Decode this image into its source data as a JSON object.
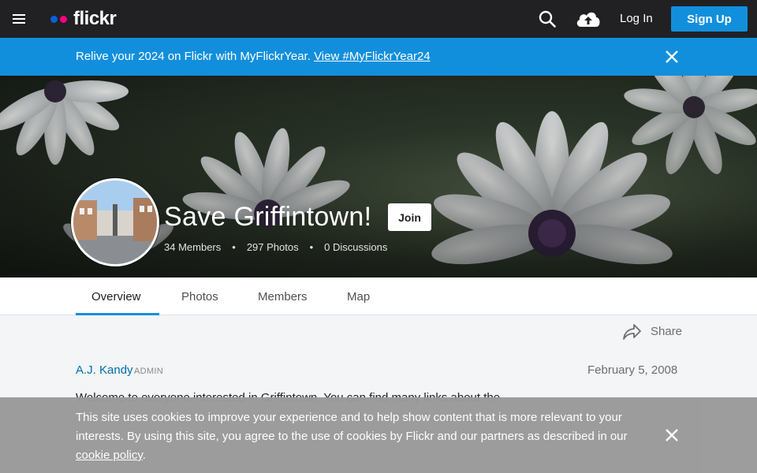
{
  "nav": {
    "logo_text": "flickr",
    "login_label": "Log In",
    "signup_label": "Sign Up"
  },
  "banner": {
    "text": "Relive your 2024 on Flickr with MyFlickrYear.",
    "link_text": "View #MyFlickrYear24"
  },
  "group": {
    "title": "Save Griffintown!",
    "join_label": "Join",
    "members": "34 Members",
    "photos": "297 Photos",
    "discussions": "0 Discussions",
    "separator": "•"
  },
  "tabs": [
    {
      "label": "Overview",
      "active": true
    },
    {
      "label": "Photos",
      "active": false
    },
    {
      "label": "Members",
      "active": false
    },
    {
      "label": "Map",
      "active": false
    }
  ],
  "content": {
    "share_label": "Share",
    "author": "A.J. Kandy",
    "role": "ADMIN",
    "date": "February 5, 2008",
    "post_text": "Welcome to everyone interested in Griffintown. You can find many links about the"
  },
  "cookie": {
    "text": "This site uses cookies to improve your experience and to help show content that is more relevant to your interests. By using this site, you agree to the use of cookies by Flickr and our partners as described in our",
    "link_text": "cookie policy",
    "suffix": "."
  },
  "colors": {
    "nav_bg": "#212124",
    "accent_blue": "#128fdc",
    "link_blue": "#006dac",
    "flickr_blue": "#0063dc",
    "flickr_pink": "#ff0084",
    "cookie_bg": "#9a9a9a"
  },
  "icons": [
    "menu-icon",
    "search-icon",
    "upload-cloud-icon",
    "close-icon",
    "share-icon"
  ]
}
